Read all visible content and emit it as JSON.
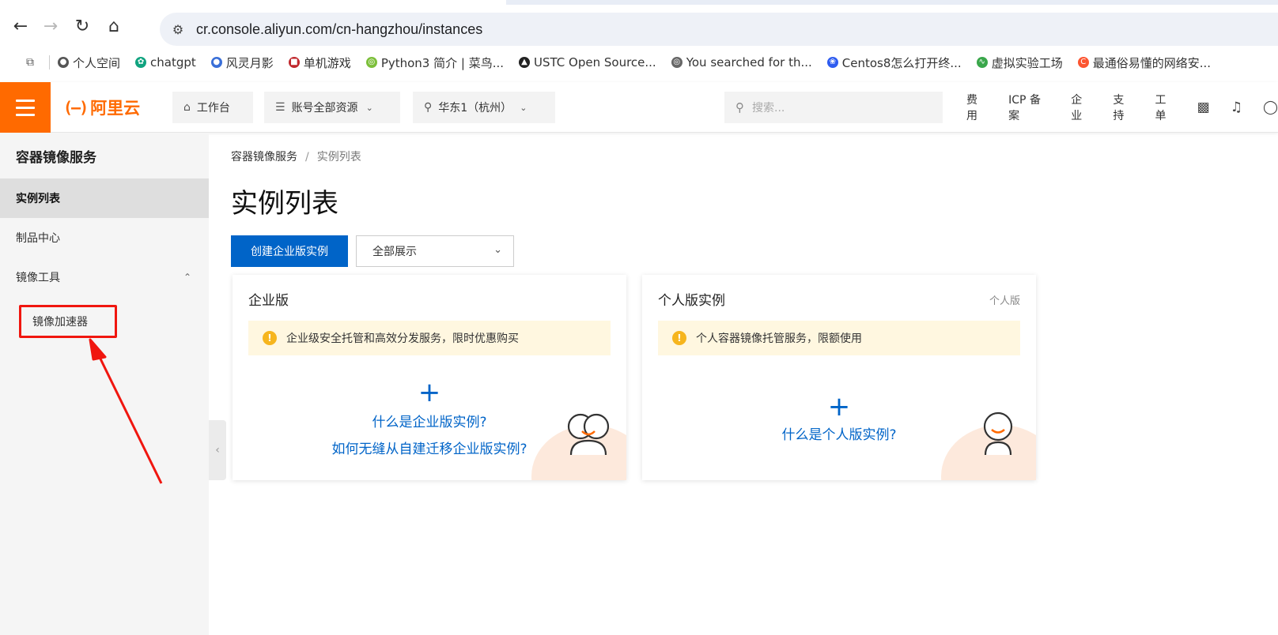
{
  "browser": {
    "url": "cr.console.aliyun.com/cn-hangzhou/instances",
    "bookmarks": [
      {
        "label": "个人空间",
        "icon": "globe-icon",
        "color": "#555555"
      },
      {
        "label": "chatgpt",
        "icon": "chatgpt-icon",
        "color": "#10a37f"
      },
      {
        "label": "风灵月影",
        "icon": "globe-icon",
        "color": "#3a6fd8"
      },
      {
        "label": "单机游戏",
        "icon": "game-icon",
        "color": "#c0282d"
      },
      {
        "label": "Python3 简介 | 菜鸟...",
        "icon": "runoob-icon",
        "color": "#7cbf3a"
      },
      {
        "label": "USTC Open Source...",
        "icon": "linux-icon",
        "color": "#222222"
      },
      {
        "label": "You searched for th...",
        "icon": "site-icon",
        "color": "#666666"
      },
      {
        "label": "Centos8怎么打开终...",
        "icon": "baidu-icon",
        "color": "#2e5cf0"
      },
      {
        "label": "虚拟实验工场",
        "icon": "lab-icon",
        "color": "#3aa74b"
      },
      {
        "label": "最通俗易懂的网络安...",
        "icon": "csdn-icon",
        "color": "#fc5531"
      }
    ]
  },
  "topbar": {
    "logo_text": "阿里云",
    "workbench": "工作台",
    "resources": "账号全部资源",
    "region": "华东1（杭州）",
    "search_placeholder": "搜索...",
    "links": [
      "费用",
      "ICP 备案",
      "企业",
      "支持",
      "工单"
    ],
    "brand_color": "#ff6a00"
  },
  "sidebar": {
    "title": "容器镜像服务",
    "items": [
      {
        "label": "实例列表",
        "active": true
      },
      {
        "label": "制品中心",
        "active": false
      },
      {
        "label": "镜像工具",
        "active": false
      }
    ],
    "sub_item": "镜像加速器"
  },
  "main": {
    "breadcrumb": [
      "容器镜像服务",
      "实例列表"
    ],
    "breadcrumb_sep": "/",
    "title": "实例列表",
    "create_button": "创建企业版实例",
    "filter_value": "全部展示",
    "primary_color": "#0064c8",
    "cards": [
      {
        "title": "企业版",
        "tag": "",
        "notice": "企业级安全托管和高效分发服务，限时优惠购买",
        "plus": "+",
        "links": [
          "什么是企业版实例?",
          "如何无缝从自建迁移企业版实例?"
        ]
      },
      {
        "title": "个人版实例",
        "tag": "个人版",
        "notice": "个人容器镜像托管服务，限额使用",
        "plus": "+",
        "links": [
          "什么是个人版实例?"
        ]
      }
    ]
  },
  "annotation": {
    "color": "#f0160f"
  }
}
